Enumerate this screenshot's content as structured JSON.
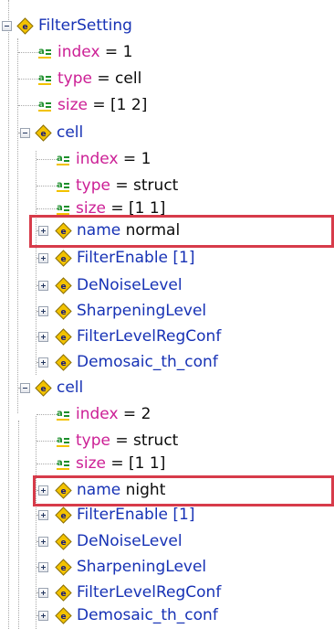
{
  "tree": {
    "root": {
      "name": "FilterSetting"
    },
    "root_attrs": [
      {
        "attr": "index",
        "value": "= 1"
      },
      {
        "attr": "type",
        "value": "= cell"
      },
      {
        "attr": "size",
        "value": "= [1 2]"
      }
    ],
    "cells": [
      {
        "name": "cell",
        "attrs": [
          {
            "attr": "index",
            "value": "= 1"
          },
          {
            "attr": "type",
            "value": "= struct"
          },
          {
            "attr": "size",
            "value": "= [1 1]"
          }
        ],
        "children": [
          {
            "name": "name",
            "value": "normal",
            "highlighted": true
          },
          {
            "name": "FilterEnable",
            "value": "[1]"
          },
          {
            "name": "DeNoiseLevel",
            "value": ""
          },
          {
            "name": "SharpeningLevel",
            "value": ""
          },
          {
            "name": "FilterLevelRegConf",
            "value": ""
          },
          {
            "name": "Demosaic_th_conf",
            "value": ""
          }
        ]
      },
      {
        "name": "cell",
        "attrs": [
          {
            "attr": "index",
            "value": "= 2"
          },
          {
            "attr": "type",
            "value": "= struct"
          },
          {
            "attr": "size",
            "value": "= [1 1]"
          }
        ],
        "children": [
          {
            "name": "name",
            "value": "night",
            "highlighted": true
          },
          {
            "name": "FilterEnable",
            "value": "[1]"
          },
          {
            "name": "DeNoiseLevel",
            "value": ""
          },
          {
            "name": "SharpeningLevel",
            "value": ""
          },
          {
            "name": "FilterLevelRegConf",
            "value": ""
          },
          {
            "name": "Demosaic_th_conf",
            "value": ""
          }
        ]
      }
    ]
  },
  "colors": {
    "element_name": "#1732b5",
    "attribute_name": "#cc1f95",
    "value_text": "#0b0b0b",
    "highlight_box": "#d73b4a",
    "tree_lines": "#a9a9a9",
    "element_icon_fill": "#f2c200",
    "attribute_icon_fill": "#1c8f2b"
  },
  "icons": {
    "element": "xml-element-icon",
    "attribute": "xml-attribute-icon",
    "expanded": "collapse-minus-icon",
    "collapsed": "expand-plus-icon"
  }
}
